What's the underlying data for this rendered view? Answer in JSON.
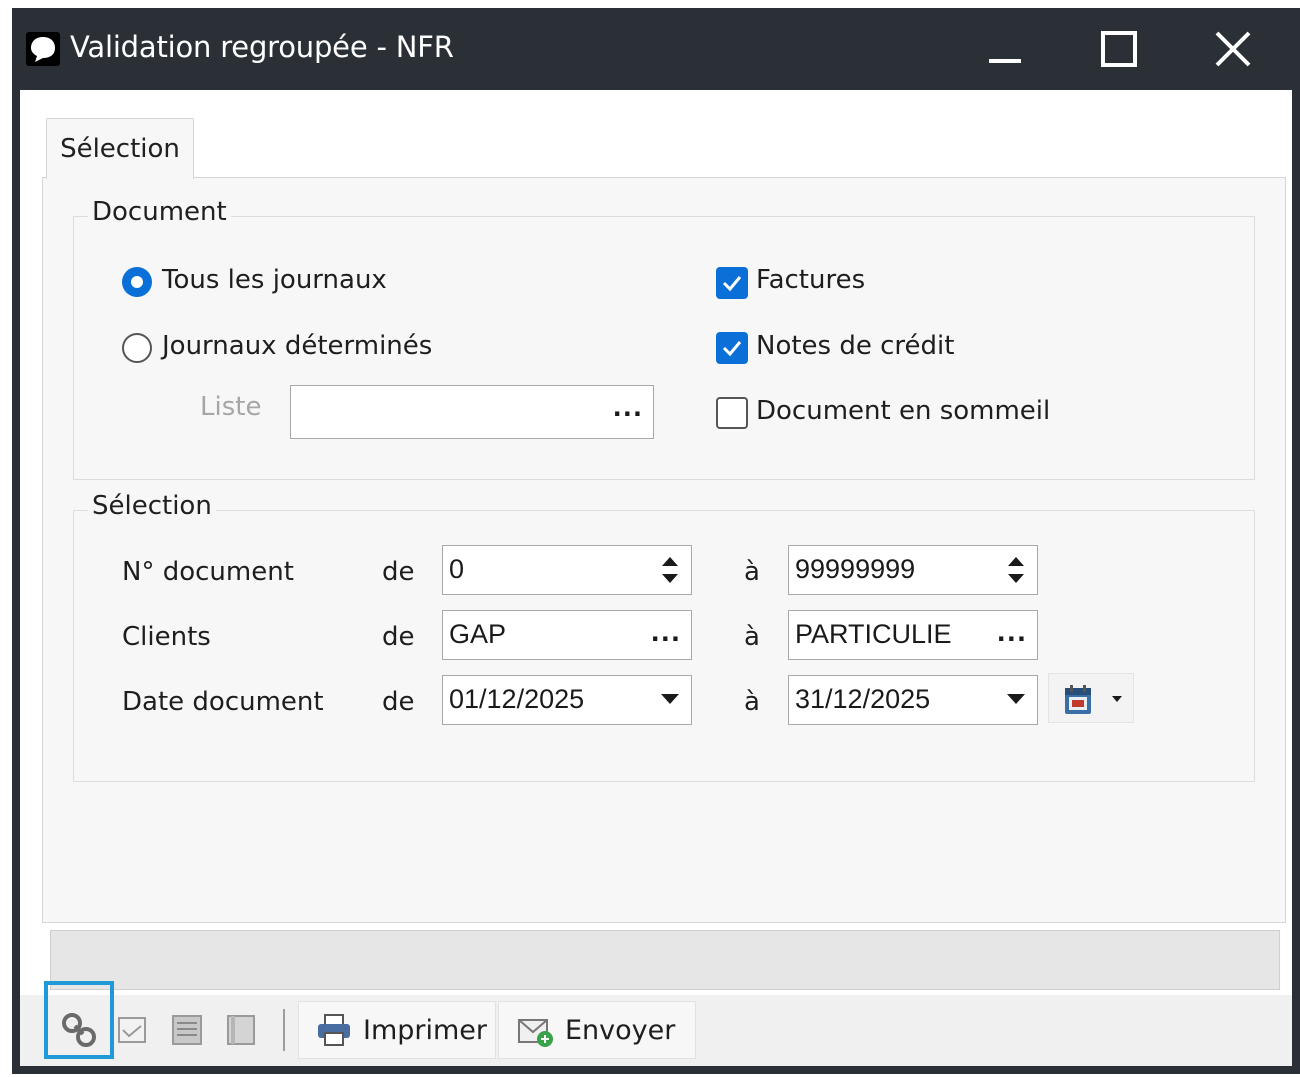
{
  "window": {
    "title": "Validation regroupée - NFR",
    "controls": {
      "minimize": "minimize-icon",
      "maximize": "maximize-icon",
      "close": "close-icon"
    }
  },
  "tabs": [
    {
      "label": "Sélection",
      "active": true
    }
  ],
  "document_group": {
    "title": "Document",
    "radio_all": {
      "label": "Tous les journaux",
      "checked": true
    },
    "radio_specific": {
      "label": "Journaux déterminés",
      "checked": false
    },
    "list_label": "Liste",
    "list_value": "",
    "list_button": "...",
    "check_invoices": {
      "label": "Factures",
      "checked": true
    },
    "check_credit_notes": {
      "label": "Notes de crédit",
      "checked": true
    },
    "check_dormant": {
      "label": "Document en sommeil",
      "checked": false
    }
  },
  "selection_group": {
    "title": "Sélection",
    "rows": [
      {
        "label": "N° document",
        "from_label": "de",
        "from": "0",
        "to_label": "à",
        "to": "99999999",
        "control": "spin"
      },
      {
        "label": "Clients",
        "from_label": "de",
        "from": "GAP",
        "to_label": "à",
        "to": "PARTICULIE",
        "control": "browse"
      },
      {
        "label": "Date document",
        "from_label": "de",
        "from": "01/12/2025",
        "to_label": "à",
        "to": "31/12/2025",
        "control": "dropdown"
      }
    ],
    "browse_label": "...",
    "calendar_button": "calendar-icon"
  },
  "toolbar": {
    "icons": [
      "link-icon",
      "envelope-icon",
      "list-icon",
      "book-icon"
    ],
    "print_label": "Imprimer",
    "send_label": "Envoyer"
  },
  "colors": {
    "titlebar": "#2b2f36",
    "accent": "#0a6fd6",
    "focus": "#1e9ad6"
  }
}
